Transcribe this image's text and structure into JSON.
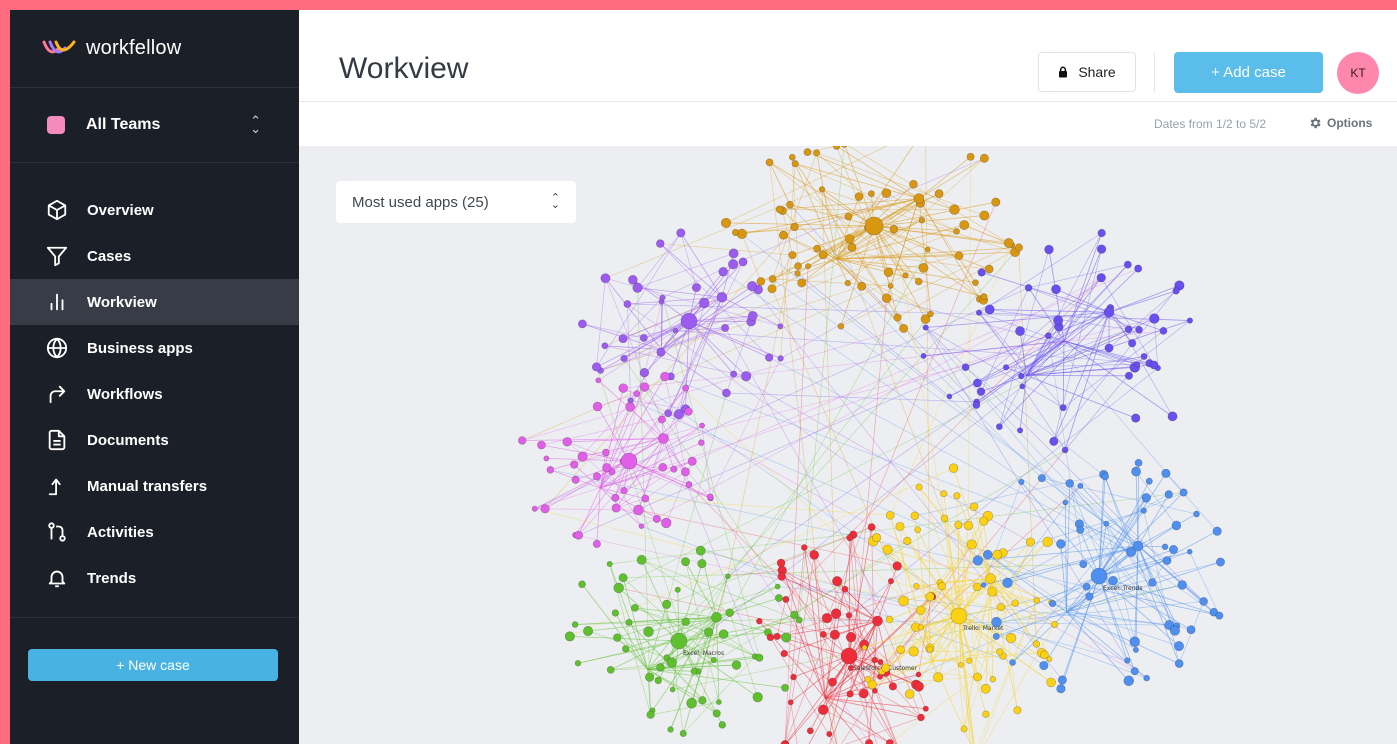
{
  "app": {
    "name": "workfellow"
  },
  "team_selector": {
    "label": "All Teams"
  },
  "nav": [
    {
      "label": "Overview",
      "icon": "cube-icon",
      "active": false
    },
    {
      "label": "Cases",
      "icon": "filter-icon",
      "active": false
    },
    {
      "label": "Workview",
      "icon": "bar-chart-icon",
      "active": true
    },
    {
      "label": "Business apps",
      "icon": "globe-icon",
      "active": false
    },
    {
      "label": "Workflows",
      "icon": "redirect-arrow-icon",
      "active": false
    },
    {
      "label": "Documents",
      "icon": "document-icon",
      "active": false
    },
    {
      "label": "Manual transfers",
      "icon": "transfer-arrow-icon",
      "active": false
    },
    {
      "label": "Activities",
      "icon": "git-branch-icon",
      "active": false
    },
    {
      "label": "Trends",
      "icon": "bell-icon",
      "active": false
    }
  ],
  "new_case_label": "+ New case",
  "header": {
    "title": "Workview",
    "share_label": "Share",
    "add_case_label": "+ Add case",
    "avatar_initials": "KT"
  },
  "subbar": {
    "dates": "Dates from 1/2 to 5/2",
    "options_label": "Options"
  },
  "graph": {
    "dropdown_value": "Most used apps (25)",
    "clusters": [
      {
        "color": "#d9960f",
        "label": ""
      },
      {
        "color": "#9d5cf0",
        "label": ""
      },
      {
        "color": "#e05ee8",
        "label": ""
      },
      {
        "color": "#6a4ff0",
        "label": ""
      },
      {
        "color": "#5fc02d",
        "label": "Excel: Macros"
      },
      {
        "color": "#ef2d3a",
        "label": "Salesforce: Customer"
      },
      {
        "color": "#fcd113",
        "label": "Trello: Market"
      },
      {
        "color": "#4e8ff0",
        "label": "Excel: Trends"
      }
    ],
    "colors": {
      "orange": "#e59a11",
      "violet": "#9d5cf0",
      "magenta": "#e05ee8",
      "indigo": "#6a4ff0",
      "green": "#5fc02d",
      "red": "#ef2d3a",
      "yellow": "#fcd113",
      "blue": "#4e8ff0"
    }
  },
  "colors": {
    "accent": "#48b3e3",
    "frame": "#ff6b7f",
    "sidebar_bg": "#1b1f27"
  }
}
